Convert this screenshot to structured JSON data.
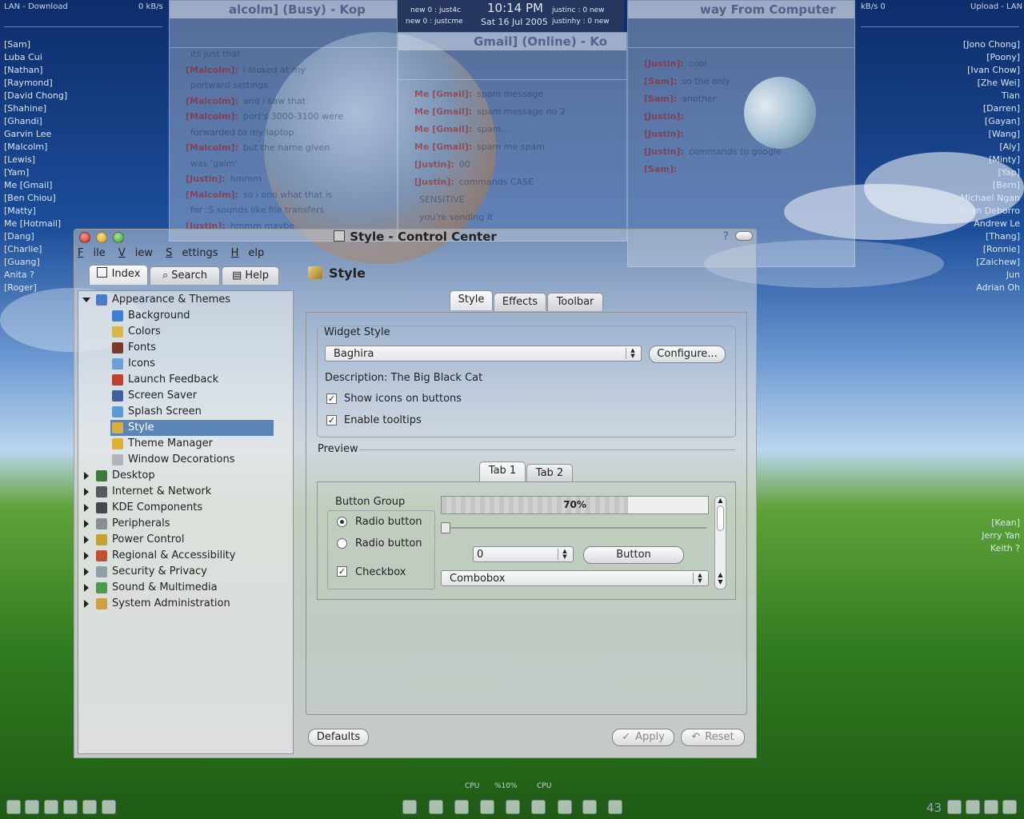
{
  "desktop": {
    "net_left_label": "LAN - Download",
    "net_left_value": "0 kB/s",
    "net_right_value": "kB/s 0",
    "net_right_label": "Upload - LAN",
    "left_buddies": [
      "[Sam]",
      "Luba Cui",
      "[Nathan]",
      "[Raymond]",
      "[David Chong]",
      "[Shahine]",
      "[Ghandi]",
      "Garvin Lee",
      "[Malcolm]",
      "[Lewis]",
      "[Yam]",
      "Me [Gmail]",
      "[Ben Chiou]",
      "[Matty]",
      "Me [Hotmail]",
      "[Dang]",
      "[Charlie]",
      "[Guang]",
      "Anita ?",
      "[Roger]"
    ],
    "right_buddies": [
      "[Jono Chong]",
      "[Poony]",
      "[Ivan Chow]",
      "[Zhe Wei]",
      "Tian",
      "[Darren]",
      "[Gayan]",
      "[Wang]",
      "[Aly]",
      "[Minty]",
      "[Yap]",
      "[Bern]",
      "Michael Ngan",
      "Sean Deborro",
      "Andrew Le",
      "[Thang]",
      "[Ronnie]",
      "[Zaichew]",
      "Jun",
      "Adrian Oh"
    ],
    "right_buddies_2": [
      "[Kean]",
      "Jerry Yan",
      "Keith ?"
    ],
    "clock": {
      "left_top": "new  0   :  just4c",
      "left_bottom": "new  0   :  justcme",
      "time": "10:14 PM",
      "date": "Sat 16 Jul 2005",
      "right_top": "justinc :    0  new",
      "right_bottom": "justinhy :    0  new"
    },
    "taskbar": {
      "cpu_left": "CPU",
      "cpu_pct": "%10%",
      "cpu_right": "CPU",
      "tray_count": "43"
    }
  },
  "chats": {
    "left_title": "alcolm] (Busy) - Kop",
    "middle_title": "Gmail] (Online) - Ko",
    "right_title": "way From Computer",
    "left_lines": [
      {
        "who": "",
        "text": "its just that"
      },
      {
        "who": "[Malcolm]:",
        "text": "i looked at my"
      },
      {
        "who": "",
        "text": "portward settings"
      },
      {
        "who": "[Malcolm]:",
        "text": "and i saw that"
      },
      {
        "who": "[Malcolm]:",
        "text": "port's 3000-3100 were"
      },
      {
        "who": "",
        "text": "forwarded to my laptop"
      },
      {
        "who": "[Malcolm]:",
        "text": "but the name given"
      },
      {
        "who": "",
        "text": "was 'gaim'"
      },
      {
        "who": "[Justin]:",
        "text": "hmmm"
      },
      {
        "who": "[Malcolm]:",
        "text": "so i ono what that is"
      },
      {
        "who": "",
        "text": "for :S sounds like file transfers"
      },
      {
        "who": "[Justin]:",
        "text": "hmmm maybe"
      }
    ],
    "middle_lines": [
      {
        "who": "Me [Gmail]:",
        "text": "spam message"
      },
      {
        "who": "Me [Gmail]:",
        "text": "spam message no 2"
      },
      {
        "who": "Me [Gmail]:",
        "text": "spam..."
      },
      {
        "who": "Me [Gmail]:",
        "text": "spam me spam"
      },
      {
        "who": "[Justin]:",
        "text": "00"
      },
      {
        "who": "[Justin]:",
        "text": "commands CASE"
      },
      {
        "who": "",
        "text": "SENSITIVE"
      },
      {
        "who": "",
        "text": "you're sending it"
      }
    ],
    "right_lines": [
      {
        "who": "[Justin]:",
        "text": "cool"
      },
      {
        "who": "[Sam]:",
        "text": "so the only"
      },
      {
        "who": "[Sam]:",
        "text": "another"
      },
      {
        "who": "[Justin]:",
        "text": ""
      },
      {
        "who": "[Justin]:",
        "text": ""
      },
      {
        "who": "[Justin]:",
        "text": "commands to google"
      },
      {
        "who": "[Sam]:",
        "text": ""
      }
    ]
  },
  "window": {
    "title": "Style - Control Center",
    "help_glyph": "?",
    "menu": [
      "File",
      "View",
      "Settings",
      "Help"
    ],
    "side_tabs": [
      "Index",
      "Search",
      "Help"
    ],
    "tree": [
      {
        "label": "Appearance & Themes",
        "level": 0,
        "expanded": true,
        "color": "#4a7bc8"
      },
      {
        "label": "Background",
        "level": 1,
        "color": "#3f7fd0"
      },
      {
        "label": "Colors",
        "level": 1,
        "color": "#d9b64a"
      },
      {
        "label": "Fonts",
        "level": 1,
        "color": "#7a3a2a"
      },
      {
        "label": "Icons",
        "level": 1,
        "color": "#6aa0d8"
      },
      {
        "label": "Launch Feedback",
        "level": 1,
        "color": "#c04030"
      },
      {
        "label": "Screen Saver",
        "level": 1,
        "color": "#4060a0"
      },
      {
        "label": "Splash Screen",
        "level": 1,
        "color": "#5a9ad6"
      },
      {
        "label": "Style",
        "level": 1,
        "color": "#d8b040",
        "selected": true
      },
      {
        "label": "Theme Manager",
        "level": 1,
        "color": "#e0b030"
      },
      {
        "label": "Window Decorations",
        "level": 1,
        "color": "#b0b4b8"
      },
      {
        "label": "Desktop",
        "level": 0,
        "color": "#3a7a3a"
      },
      {
        "label": "Internet & Network",
        "level": 0,
        "color": "#555a60"
      },
      {
        "label": "KDE Components",
        "level": 0,
        "color": "#444850"
      },
      {
        "label": "Peripherals",
        "level": 0,
        "color": "#8a8e94"
      },
      {
        "label": "Power Control",
        "level": 0,
        "color": "#c8a030"
      },
      {
        "label": "Regional & Accessibility",
        "level": 0,
        "color": "#c05030"
      },
      {
        "label": "Security & Privacy",
        "level": 0,
        "color": "#90a0a8"
      },
      {
        "label": "Sound & Multimedia",
        "level": 0,
        "color": "#4a9a50"
      },
      {
        "label": "System Administration",
        "level": 0,
        "color": "#d0a040"
      }
    ],
    "panel_title": "Style",
    "tabs": [
      "Style",
      "Effects",
      "Toolbar"
    ],
    "widget_style_label": "Widget Style",
    "widget_style_value": "Baghira",
    "configure_label": "Configure...",
    "description": "Description: The Big Black Cat",
    "show_icons_label": "Show icons on buttons",
    "show_icons_checked": true,
    "tooltips_label": "Enable tooltips",
    "tooltips_checked": true,
    "preview_label": "Preview",
    "preview_tabs": [
      "Tab 1",
      "Tab 2"
    ],
    "button_group_label": "Button Group",
    "radio1_label": "Radio button",
    "radio2_label": "Radio button",
    "checkbox_label": "Checkbox",
    "progress_pct": 70,
    "progress_text": "70%",
    "spin_value": "0",
    "button_label": "Button",
    "combobox_label": "Combobox",
    "defaults_label": "Defaults",
    "apply_label": "Apply",
    "reset_label": "Reset",
    "colors": {
      "selection": "#5b84b8",
      "progress": "#c9ccc9"
    }
  }
}
